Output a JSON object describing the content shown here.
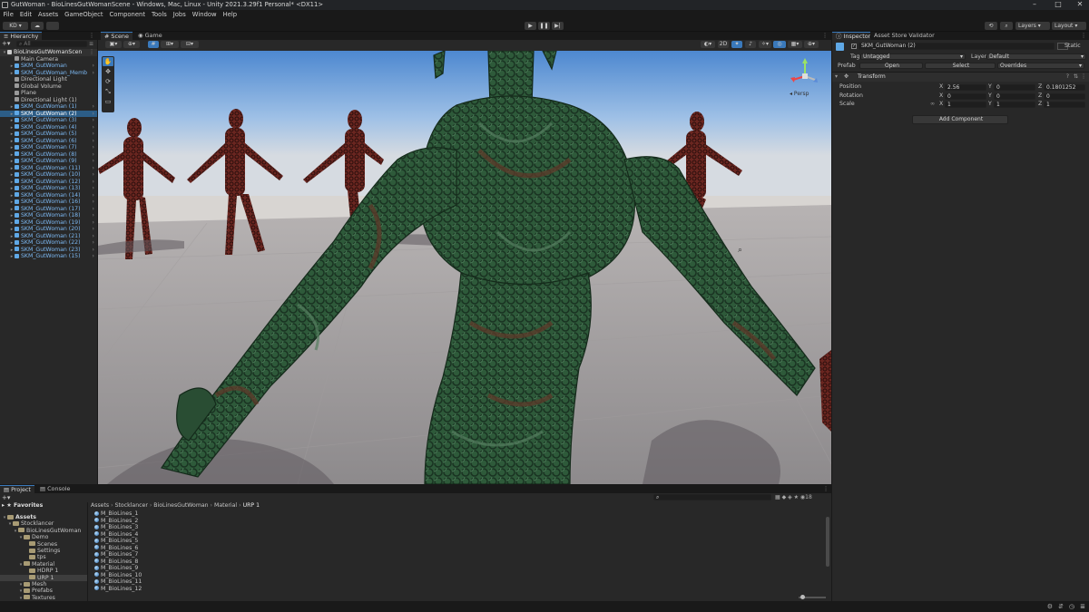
{
  "window": {
    "title": "GutWoman - BioLinesGutWomanScene - Windows, Mac, Linux - Unity 2021.3.29f1 Personal* <DX11>",
    "controls": [
      "–",
      "□",
      "✕"
    ]
  },
  "menu": [
    "File",
    "Edit",
    "Assets",
    "GameObject",
    "Component",
    "Tools",
    "Jobs",
    "Window",
    "Help"
  ],
  "toolbar": {
    "account_label": "KD",
    "play_icon": "play-icon",
    "pause_icon": "pause-icon",
    "step_icon": "step-icon",
    "layers_label": "Layers",
    "layout_label": "Layout"
  },
  "hierarchy": {
    "tab_label": "Hierarchy",
    "search_placeholder": "All",
    "scene_name": "BioLinesGutWomanScen",
    "items": [
      {
        "label": "Main Camera",
        "type": "grey",
        "indent": 2,
        "expand": false
      },
      {
        "label": "SKM_GutWoman",
        "type": "blue",
        "indent": 2,
        "expand": true
      },
      {
        "label": "SKM_GutWoman_Memb",
        "type": "blue",
        "indent": 2,
        "expand": true
      },
      {
        "label": "Directional Light",
        "type": "grey",
        "indent": 2,
        "expand": false
      },
      {
        "label": "Global Volume",
        "type": "grey",
        "indent": 2,
        "expand": false
      },
      {
        "label": "Plane",
        "type": "grey",
        "indent": 2,
        "expand": false
      },
      {
        "label": "Directional Light (1)",
        "type": "grey",
        "indent": 2,
        "expand": false
      },
      {
        "label": "SKM_GutWoman (1)",
        "type": "blue",
        "indent": 2,
        "expand": true
      },
      {
        "label": "SKM_GutWoman (2)",
        "type": "blue",
        "indent": 2,
        "expand": true,
        "selected": true
      },
      {
        "label": "SKM_GutWoman (3)",
        "type": "blue",
        "indent": 2,
        "expand": true
      },
      {
        "label": "SKM_GutWoman (4)",
        "type": "blue",
        "indent": 2,
        "expand": true
      },
      {
        "label": "SKM_GutWoman (5)",
        "type": "blue",
        "indent": 2,
        "expand": true
      },
      {
        "label": "SKM_GutWoman (6)",
        "type": "blue",
        "indent": 2,
        "expand": true
      },
      {
        "label": "SKM_GutWoman (7)",
        "type": "blue",
        "indent": 2,
        "expand": true
      },
      {
        "label": "SKM_GutWoman (8)",
        "type": "blue",
        "indent": 2,
        "expand": true
      },
      {
        "label": "SKM_GutWoman (9)",
        "type": "blue",
        "indent": 2,
        "expand": true
      },
      {
        "label": "SKM_GutWoman (11)",
        "type": "blue",
        "indent": 2,
        "expand": true
      },
      {
        "label": "SKM_GutWoman (10)",
        "type": "blue",
        "indent": 2,
        "expand": true
      },
      {
        "label": "SKM_GutWoman (12)",
        "type": "blue",
        "indent": 2,
        "expand": true
      },
      {
        "label": "SKM_GutWoman (13)",
        "type": "blue",
        "indent": 2,
        "expand": true
      },
      {
        "label": "SKM_GutWoman (14)",
        "type": "blue",
        "indent": 2,
        "expand": true
      },
      {
        "label": "SKM_GutWoman (16)",
        "type": "blue",
        "indent": 2,
        "expand": true
      },
      {
        "label": "SKM_GutWoman (17)",
        "type": "blue",
        "indent": 2,
        "expand": true
      },
      {
        "label": "SKM_GutWoman (18)",
        "type": "blue",
        "indent": 2,
        "expand": true
      },
      {
        "label": "SKM_GutWoman (19)",
        "type": "blue",
        "indent": 2,
        "expand": true
      },
      {
        "label": "SKM_GutWoman (20)",
        "type": "blue",
        "indent": 2,
        "expand": true
      },
      {
        "label": "SKM_GutWoman (21)",
        "type": "blue",
        "indent": 2,
        "expand": true
      },
      {
        "label": "SKM_GutWoman (22)",
        "type": "blue",
        "indent": 2,
        "expand": true
      },
      {
        "label": "SKM_GutWoman (23)",
        "type": "blue",
        "indent": 2,
        "expand": true
      },
      {
        "label": "SKM_GutWoman (15)",
        "type": "blue",
        "indent": 2,
        "expand": true
      }
    ]
  },
  "scene": {
    "tabs": [
      "Scene",
      "Game"
    ],
    "mode_2d": "2D",
    "gizmo_label": "◂ Persp"
  },
  "inspector": {
    "tabs": [
      "Inspector",
      "Asset Store Validator"
    ],
    "object_name": "SKM_GutWoman (2)",
    "static_label": "Static",
    "tag_label": "Tag",
    "tag_value": "Untagged",
    "layer_label": "Layer",
    "layer_value": "Default",
    "prefab_label": "Prefab",
    "prefab_buttons": [
      "Open",
      "Select",
      "Overrides"
    ],
    "transform": {
      "header": "Transform",
      "rows": [
        {
          "label": "Position",
          "x": "2.56",
          "y": "0",
          "z": "0.1801252"
        },
        {
          "label": "Rotation",
          "x": "0",
          "y": "0",
          "z": "0"
        },
        {
          "label": "Scale",
          "x": "1",
          "y": "1",
          "z": "1"
        }
      ]
    },
    "add_component": "Add Component"
  },
  "project": {
    "tabs": [
      "Project",
      "Console"
    ],
    "favorites_label": "Favorites",
    "tree": [
      {
        "label": "Assets",
        "indent": 0,
        "bold": true
      },
      {
        "label": "Stocklancer",
        "indent": 1
      },
      {
        "label": "BioLinesGutWoman",
        "indent": 2
      },
      {
        "label": "Demo",
        "indent": 3
      },
      {
        "label": "Scenes",
        "indent": 4
      },
      {
        "label": "Settings",
        "indent": 4
      },
      {
        "label": "tps",
        "indent": 4
      },
      {
        "label": "Material",
        "indent": 3
      },
      {
        "label": "HDRP 1",
        "indent": 4
      },
      {
        "label": "URP 1",
        "indent": 4,
        "selected": true
      },
      {
        "label": "Mesh",
        "indent": 3
      },
      {
        "label": "Prefabs",
        "indent": 3
      },
      {
        "label": "Textures",
        "indent": 3
      }
    ],
    "breadcrumb": [
      "Assets",
      "Stocklancer",
      "BioLinesGutWoman",
      "Material",
      "URP 1"
    ],
    "assets": [
      "M_BioLines_1",
      "M_BioLines_2",
      "M_BioLines_3",
      "M_BioLines_4",
      "M_BioLines_5",
      "M_BioLines_6",
      "M_BioLines_7",
      "M_BioLines_8",
      "M_BioLines_9",
      "M_BioLines_10",
      "M_BioLines_11",
      "M_BioLines_12"
    ],
    "count_badge": "18"
  },
  "colors": {
    "accent": "#3a79bb",
    "prefab_blue": "#7cb8f2",
    "selection": "#2c5d87",
    "sky_top": "#5b8fd1",
    "ground": "#a7a3a4"
  }
}
